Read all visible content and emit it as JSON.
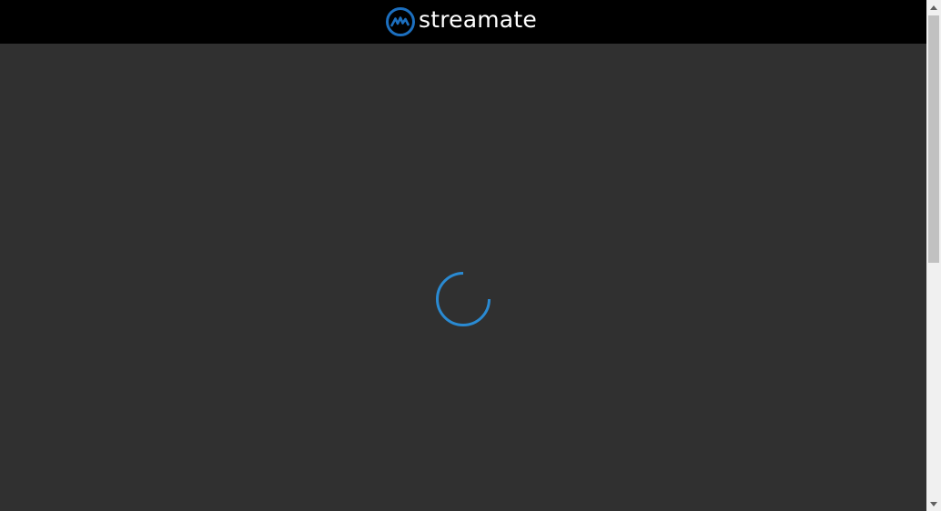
{
  "header": {
    "brand_name": "streamate",
    "logo_icon": "streamate-logo-icon",
    "background_color": "#000000"
  },
  "main": {
    "background_color": "#303030",
    "loading_spinner": {
      "icon": "loading-spinner-icon",
      "color": "#2a8ad2"
    }
  },
  "colors": {
    "accent": "#2a8ad2",
    "logo_blue": "#1c6fbf",
    "text": "#ffffff"
  }
}
